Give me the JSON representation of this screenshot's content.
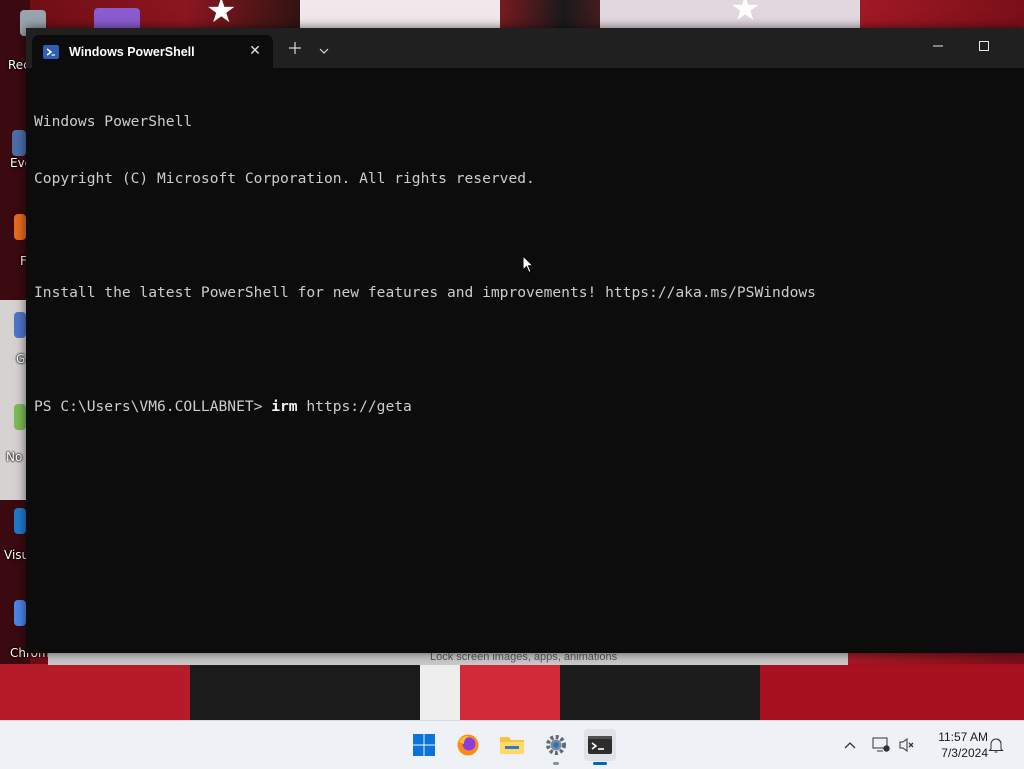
{
  "desktop": {
    "icons": [
      {
        "label": "Rec"
      },
      {
        "label": "Eve"
      },
      {
        "label": "F"
      },
      {
        "label": "G"
      },
      {
        "label": "No"
      },
      {
        "label": "Visu"
      },
      {
        "label": "Chrom"
      }
    ],
    "background_window_text": "Lock screen images, apps, animations"
  },
  "terminal": {
    "tab_title": "Windows PowerShell",
    "tab_icon": "powershell-icon",
    "lines": [
      "Windows PowerShell",
      "Copyright (C) Microsoft Corporation. All rights reserved.",
      "",
      "Install the latest PowerShell for new features and improvements! https://aka.ms/PSWindows",
      ""
    ],
    "prompt": "PS C:\\Users\\VM6.COLLABNET> ",
    "command": "irm",
    "argument": " https://geta",
    "colors": {
      "background": "#0c0c0c",
      "titlebar": "#202020",
      "text": "#cccccc"
    }
  },
  "taskbar": {
    "apps": [
      {
        "name": "start-button",
        "icon": "windows-icon"
      },
      {
        "name": "firefox",
        "icon": "firefox-icon"
      },
      {
        "name": "file-explorer",
        "icon": "folder-icon"
      },
      {
        "name": "settings",
        "icon": "gear-icon"
      },
      {
        "name": "terminal",
        "icon": "terminal-icon",
        "active": true
      }
    ],
    "time": "11:57 AM",
    "date": "7/3/2024",
    "accent": "#0067c0"
  }
}
